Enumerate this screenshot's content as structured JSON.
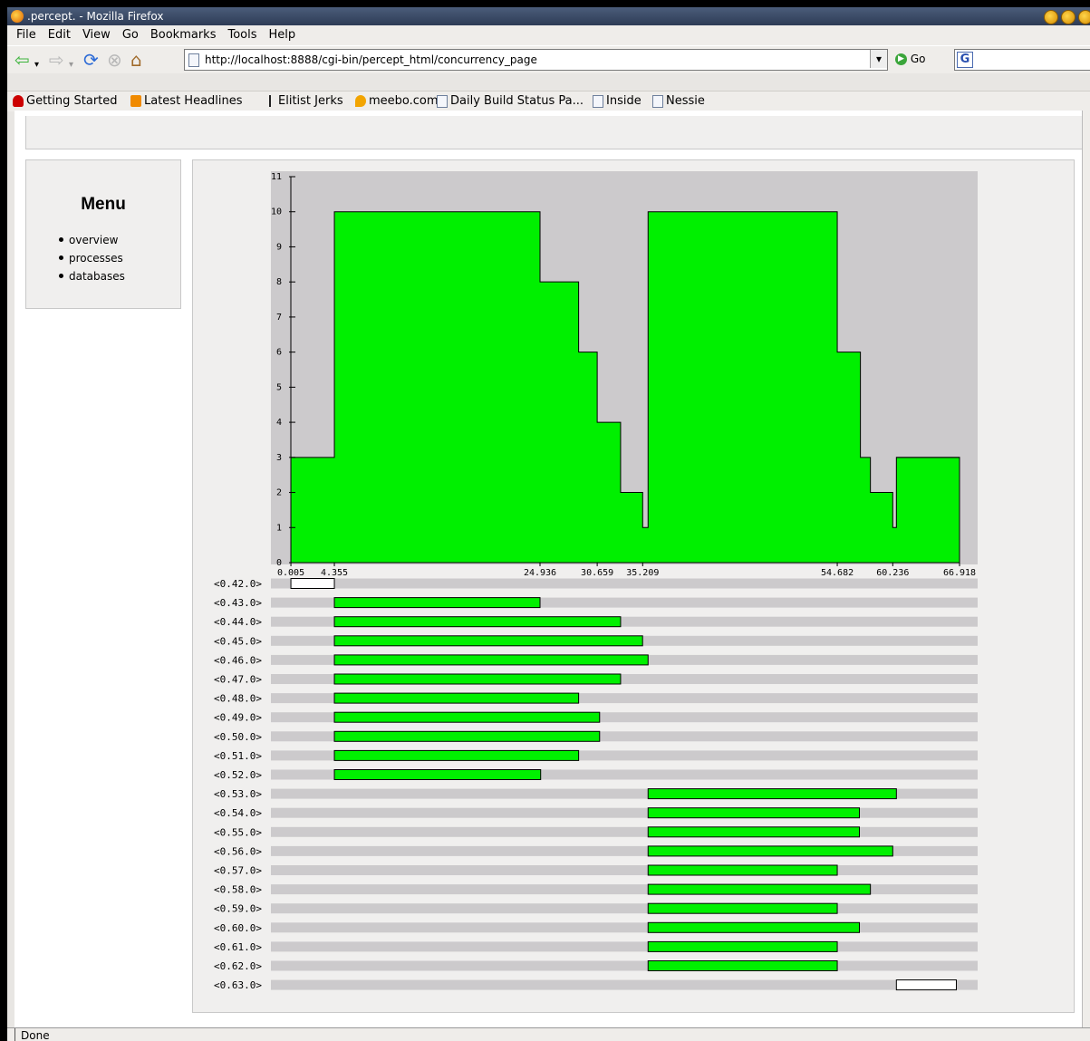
{
  "window": {
    "title": ".percept. - Mozilla Firefox"
  },
  "menubar": {
    "items": [
      "File",
      "Edit",
      "View",
      "Go",
      "Bookmarks",
      "Tools",
      "Help"
    ],
    "underline": [
      "F",
      "E",
      "V",
      "G",
      "B",
      "T",
      "H"
    ]
  },
  "toolbar": {
    "url": "http://localhost:8888/cgi-bin/percept_html/concurrency_page",
    "go_label": "Go"
  },
  "bookmarks": [
    {
      "label": "Getting Started",
      "icon": "redhat-icon"
    },
    {
      "label": "Latest Headlines",
      "icon": "rss-icon"
    },
    {
      "label": "Elitist Jerks",
      "icon": "stick-icon"
    },
    {
      "label": "meebo.com",
      "icon": "meebo-icon"
    },
    {
      "label": "Daily Build Status Pa...",
      "icon": "page-icon"
    },
    {
      "label": "Inside",
      "icon": "page-icon"
    },
    {
      "label": "Nessie",
      "icon": "page-icon"
    }
  ],
  "sidebar": {
    "title": "Menu",
    "items": [
      {
        "label": "overview"
      },
      {
        "label": "processes"
      },
      {
        "label": "databases"
      }
    ]
  },
  "status": {
    "text": "Done"
  },
  "colors": {
    "fill": "#00f000",
    "plot_bg": "#cccacc",
    "lane_bg": "#cccacc",
    "white_bar": "#ffffff"
  },
  "chart_data": [
    {
      "type": "area",
      "step": true,
      "x_ticks": [
        "0.005",
        "4.355",
        "24.936",
        "30.659",
        "35.209",
        "54.682",
        "60.236",
        "66.918"
      ],
      "xlim": [
        0,
        66.918
      ],
      "y_ticks": [
        0,
        1,
        2,
        3,
        4,
        5,
        6,
        7,
        8,
        9,
        10,
        11
      ],
      "ylim": [
        0,
        11
      ],
      "x": [
        0.005,
        4.355,
        24.936,
        28.8,
        30.659,
        33.0,
        35.209,
        35.75,
        54.682,
        57.0,
        58.0,
        60.236,
        60.6,
        66.918
      ],
      "values": [
        3,
        10,
        8,
        6,
        4,
        2,
        1,
        10,
        6,
        3,
        2,
        1,
        3,
        3
      ]
    },
    {
      "type": "bar",
      "orientation": "horizontal",
      "xlim": [
        0,
        66.918
      ],
      "rows": [
        {
          "label": "<0.42.0>",
          "start": 0.005,
          "end": 4.355,
          "active": false
        },
        {
          "label": "<0.43.0>",
          "start": 4.355,
          "end": 24.936,
          "active": true
        },
        {
          "label": "<0.44.0>",
          "start": 4.355,
          "end": 33.0,
          "active": true
        },
        {
          "label": "<0.45.0>",
          "start": 4.355,
          "end": 35.2,
          "active": true
        },
        {
          "label": "<0.46.0>",
          "start": 4.355,
          "end": 35.75,
          "active": true
        },
        {
          "label": "<0.47.0>",
          "start": 4.355,
          "end": 33.0,
          "active": true
        },
        {
          "label": "<0.48.0>",
          "start": 4.355,
          "end": 28.8,
          "active": true
        },
        {
          "label": "<0.49.0>",
          "start": 4.355,
          "end": 30.9,
          "active": true
        },
        {
          "label": "<0.50.0>",
          "start": 4.355,
          "end": 30.9,
          "active": true
        },
        {
          "label": "<0.51.0>",
          "start": 4.355,
          "end": 28.8,
          "active": true
        },
        {
          "label": "<0.52.0>",
          "start": 4.355,
          "end": 25.0,
          "active": true
        },
        {
          "label": "<0.53.0>",
          "start": 35.75,
          "end": 60.6,
          "active": true
        },
        {
          "label": "<0.54.0>",
          "start": 35.75,
          "end": 56.9,
          "active": true
        },
        {
          "label": "<0.55.0>",
          "start": 35.75,
          "end": 56.9,
          "active": true
        },
        {
          "label": "<0.56.0>",
          "start": 35.75,
          "end": 60.236,
          "active": true
        },
        {
          "label": "<0.57.0>",
          "start": 35.75,
          "end": 54.682,
          "active": true
        },
        {
          "label": "<0.58.0>",
          "start": 35.75,
          "end": 58.0,
          "active": true
        },
        {
          "label": "<0.59.0>",
          "start": 35.75,
          "end": 54.682,
          "active": true
        },
        {
          "label": "<0.60.0>",
          "start": 35.75,
          "end": 56.9,
          "active": true
        },
        {
          "label": "<0.61.0>",
          "start": 35.75,
          "end": 54.682,
          "active": true
        },
        {
          "label": "<0.62.0>",
          "start": 35.75,
          "end": 54.682,
          "active": true
        },
        {
          "label": "<0.63.0>",
          "start": 60.6,
          "end": 66.6,
          "active": false
        }
      ]
    }
  ]
}
